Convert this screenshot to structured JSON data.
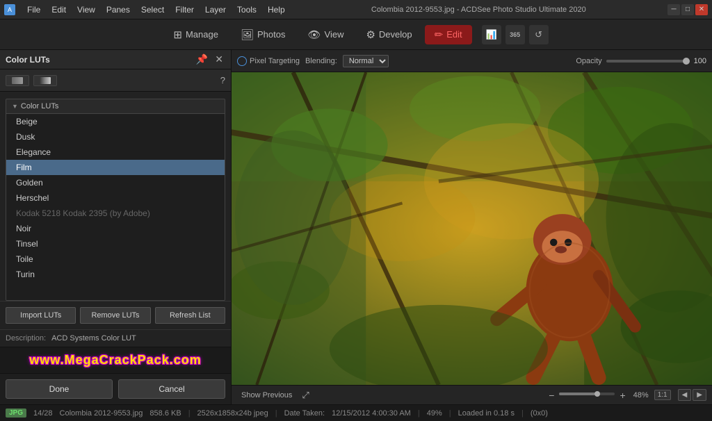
{
  "titlebar": {
    "title": "Colombia 2012-9553.jpg - ACDSee Photo Studio Ultimate 2020",
    "menus": [
      "File",
      "Edit",
      "View",
      "Panes",
      "Select",
      "Filter",
      "Layer",
      "Tools",
      "Help"
    ]
  },
  "toolbar": {
    "manage_label": "Manage",
    "photos_label": "Photos",
    "view_label": "View",
    "develop_label": "Develop",
    "edit_label": "Edit"
  },
  "panel": {
    "title": "Color LUTs",
    "section_label": "Color LUTs",
    "luts": [
      {
        "name": "Beige",
        "disabled": false
      },
      {
        "name": "Dusk",
        "disabled": false
      },
      {
        "name": "Elegance",
        "disabled": false
      },
      {
        "name": "Film",
        "disabled": false,
        "selected": true
      },
      {
        "name": "Golden",
        "disabled": false
      },
      {
        "name": "Herschel",
        "disabled": false
      },
      {
        "name": "Kodak 5218 Kodak 2395 (by Adobe)",
        "disabled": true
      },
      {
        "name": "Noir",
        "disabled": false
      },
      {
        "name": "Tinsel",
        "disabled": false
      },
      {
        "name": "Toile",
        "disabled": false
      },
      {
        "name": "Turin",
        "disabled": false
      }
    ],
    "import_luts": "Import LUTs",
    "remove_luts": "Remove LUTs",
    "refresh_list": "Refresh List",
    "description_label": "Description:",
    "description_value": "ACD Systems Color LUT",
    "done_label": "Done",
    "cancel_label": "Cancel",
    "watermark": "www.MegaCrackPack.com"
  },
  "image_toolbar": {
    "pixel_targeting": "Pixel Targeting",
    "blending_label": "Blending:",
    "blending_value": "Normal",
    "opacity_label": "Opacity",
    "opacity_value": "100"
  },
  "image_footer": {
    "show_previous": "Show Previous",
    "zoom_pct": "48%",
    "zoom_ratio": "1:1"
  },
  "statusbar": {
    "file_type": "JPG",
    "filename": "Colombia 2012-9553.jpg",
    "filesize": "858.6 KB",
    "dimensions": "2526x1858x24b jpeg",
    "date_taken_label": "Date Taken:",
    "date_taken": "12/15/2012 4:00:30 AM",
    "zoom": "49%",
    "loaded": "Loaded in 0.18 s",
    "coords": "(0x0)",
    "position": "14/28"
  }
}
